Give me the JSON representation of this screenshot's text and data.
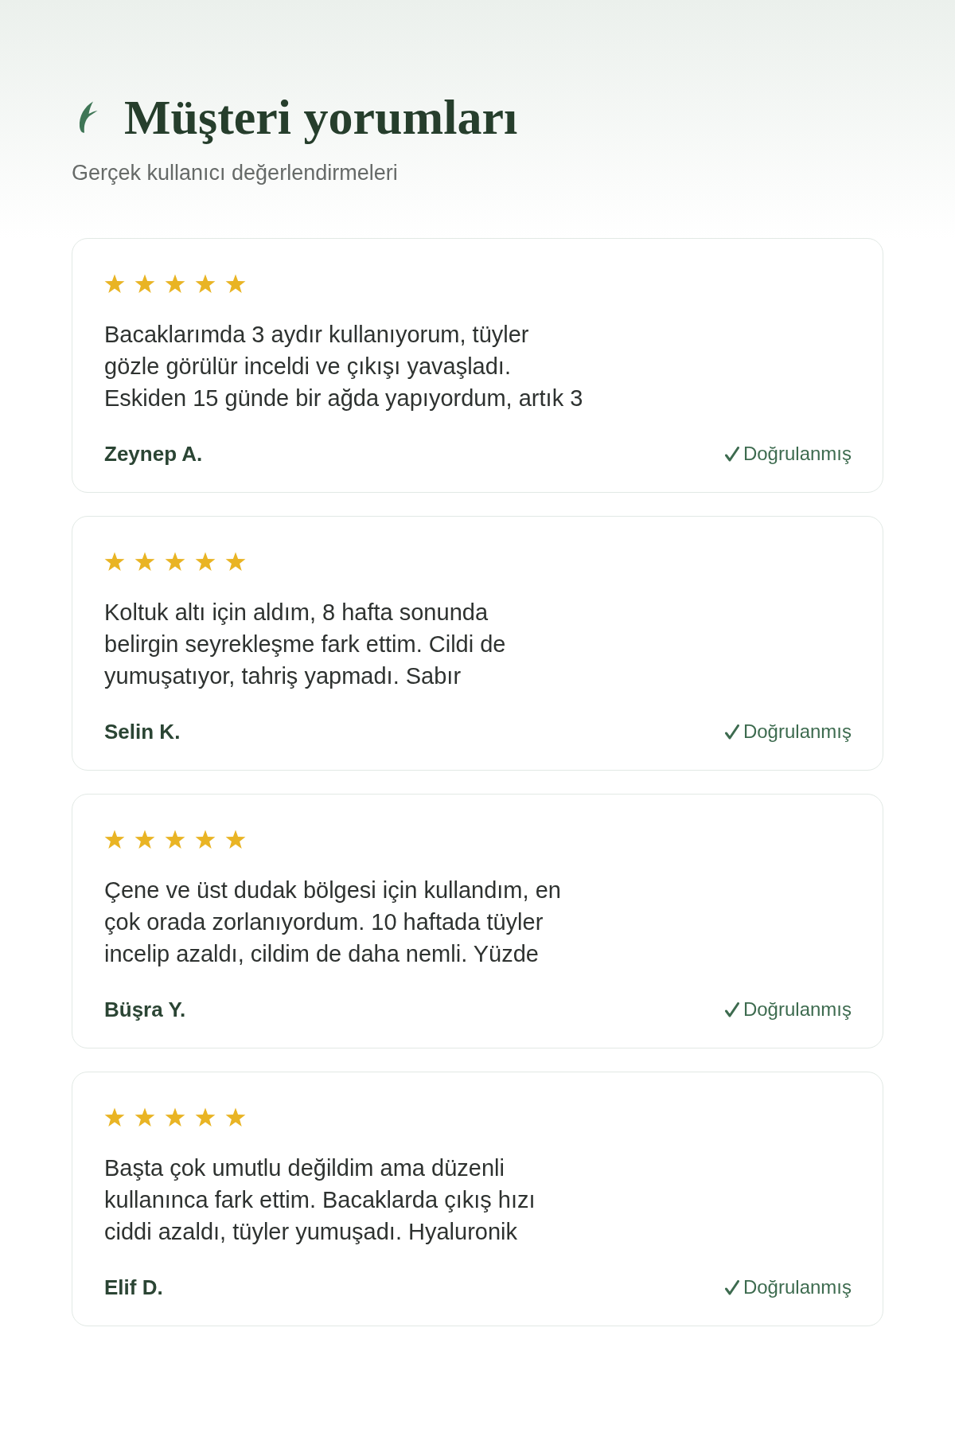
{
  "header": {
    "title": "Müşteri yorumları",
    "subtitle": "Gerçek kullanıcı değerlendirmeleri"
  },
  "reviews": [
    {
      "stars": 5,
      "text": "Bacaklarımda 3 aydır kullanıyorum, tüyler\ngözle görülür inceldi ve çıkışı yavaşladı.\nEskiden 15 günde bir ağda yapıyordum, artık 3",
      "author": "Zeynep A.",
      "badge": "Doğrulanmış"
    },
    {
      "stars": 5,
      "text": "Koltuk altı için aldım, 8 hafta sonunda\nbelirgin seyrekleşme fark ettim. Cildi de\nyumuşatıyor, tahriş yapmadı. Sabır",
      "author": "Selin K.",
      "badge": "Doğrulanmış"
    },
    {
      "stars": 5,
      "text": "Çene ve üst dudak bölgesi için kullandım, en\nçok orada zorlanıyordum. 10 haftada tüyler\nincelip azaldı, cildim de daha nemli. Yüzde",
      "author": "Büşra Y.",
      "badge": "Doğrulanmış"
    },
    {
      "stars": 5,
      "text": "Başta çok umutlu değildim ama düzenli\nkullanınca fark ettim. Bacaklarda çıkış hızı\nciddi azaldı, tüyler yumuşadı. Hyaluronik",
      "author": "Elif D.",
      "badge": "Doğrulanmış"
    }
  ]
}
